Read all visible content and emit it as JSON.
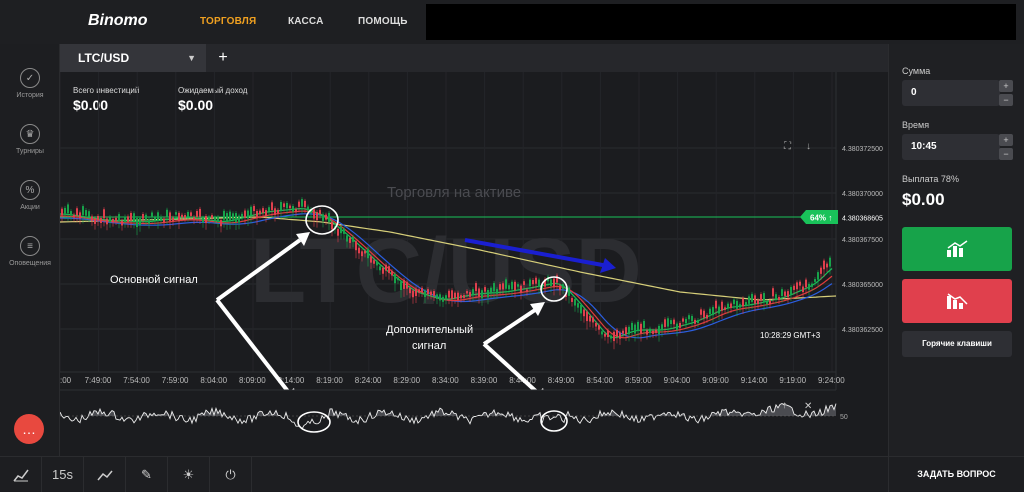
{
  "header": {
    "logo": "Binomo",
    "nav_trade": "ТОРГОВЛЯ",
    "nav_cash": "КАССА",
    "nav_help": "ПОМОЩЬ"
  },
  "sidebar": {
    "items": [
      {
        "label": "История",
        "icon": "history-icon"
      },
      {
        "label": "Турниры",
        "icon": "tournaments-icon"
      },
      {
        "label": "Акции",
        "icon": "promo-icon"
      },
      {
        "label": "Оповещения",
        "icon": "notifications-icon"
      }
    ]
  },
  "tab": {
    "asset": "LTC/USD",
    "add": "+"
  },
  "investment": {
    "total_label": "Всего инвестиций",
    "total_value": "$0.00",
    "expected_label": "Ожидаемый доход",
    "expected_value": "$0.00"
  },
  "chart": {
    "watermark_title": "Торговля на активе",
    "watermark_asset": "LTC/USD",
    "price_labels": [
      "4.380372500",
      "4.380370000",
      "4.380367500",
      "4.380365000",
      "4.380362500"
    ],
    "current_price": "4.380368605",
    "payout_badge": "64% ↑",
    "time_labels": [
      ":00",
      "7:49:00",
      "7:54:00",
      "7:59:00",
      "8:04:00",
      "8:09:00",
      "8:14:00",
      "8:19:00",
      "8:24:00",
      "8:29:00",
      "8:34:00",
      "8:39:00",
      "8:44:00",
      "8:49:00",
      "8:54:00",
      "8:59:00",
      "9:04:00",
      "9:09:00",
      "9:14:00",
      "9:19:00",
      "9:24:00"
    ],
    "server_time": "10:28:29 GMT+3",
    "osc_label": "50",
    "annotation_main": "Основной сигнал",
    "annotation_extra_1": "Дополнительный",
    "annotation_extra_2": "сигнал",
    "colors": {
      "green_line": "#19c25a",
      "yellow_ma": "#d8d07a",
      "blue_arrow": "#1a1fd0",
      "up": "#17a34a",
      "down": "#e0404d"
    }
  },
  "panel": {
    "amount_label": "Сумма",
    "amount_value": "0",
    "time_label": "Время",
    "time_value": "10:45",
    "payout_label": "Выплата 78%",
    "payout_value": "$0.00",
    "hotkeys": "Горячие клавиши",
    "plus": "+",
    "minus": "−"
  },
  "bottom": {
    "timeframe": "15s",
    "ask": "ЗАДАТЬ ВОПРОС"
  }
}
